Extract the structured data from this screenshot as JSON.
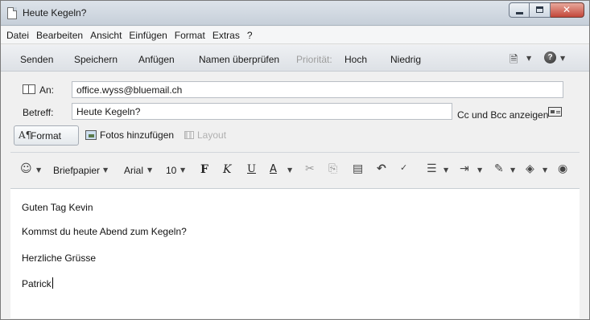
{
  "window": {
    "title": "Heute Kegeln?",
    "close_glyph": "✕"
  },
  "menu": [
    "Datei",
    "Bearbeiten",
    "Ansicht",
    "Einfügen",
    "Format",
    "Extras",
    "?"
  ],
  "toolbar": {
    "send": "Senden",
    "save": "Speichern",
    "attach": "Anfügen",
    "check_names": "Namen überprüfen",
    "priority_label": "Priorität:",
    "priority_high": "Hoch",
    "priority_low": "Niedrig"
  },
  "fields": {
    "to_label": "An:",
    "to_value": "office.wyss@bluemail.ch",
    "subject_label": "Betreff:",
    "subject_value": "Heute Kegeln?",
    "cc_bcc": "Cc und Bcc anzeigen"
  },
  "format_row": {
    "format": "Format",
    "add_photos": "Fotos hinzufügen",
    "layout": "Layout"
  },
  "formatting": {
    "stationery": "Briefpapier",
    "font": "Arial",
    "size": "10",
    "bold": "F",
    "italic": "K",
    "underline": "U",
    "color": "A"
  },
  "body": {
    "lines": [
      "Guten Tag Kevin",
      "Kommst du heute Abend zum Kegeln?",
      "Herzliche Grüsse",
      "Patrick"
    ]
  },
  "icons": {
    "stationery": "emoji-face-icon",
    "cut": "scissors-icon",
    "copy": "copy-icon",
    "paste": "clipboard-icon",
    "undo": "undo-icon",
    "spellcheck": "spellcheck-icon",
    "bullets": "bullet-list-icon",
    "indent": "indent-icon",
    "highlight": "highlighter-icon",
    "fill": "fill-bucket-icon",
    "link": "web-link-icon"
  }
}
